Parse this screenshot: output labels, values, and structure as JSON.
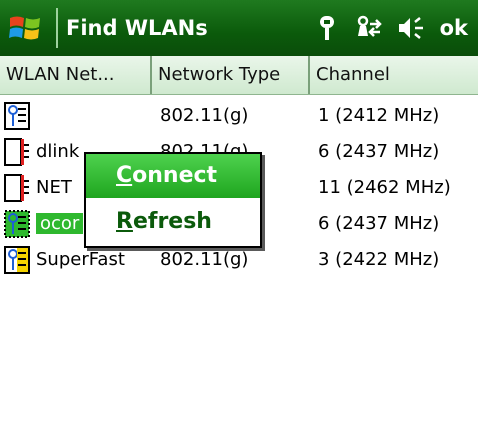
{
  "titlebar": {
    "title": "Find WLANs",
    "ok_label": "ok",
    "icons": [
      "windows-start-icon",
      "antenna-icon",
      "connectivity-icon",
      "speaker-icon"
    ]
  },
  "table": {
    "columns": [
      "WLAN Net...",
      "Network Type",
      "Channel"
    ],
    "rows": [
      {
        "name": "",
        "type": "802.11(g)",
        "channel": "1 (2412 MHz)",
        "icon": "access-point-icon",
        "selected": false
      },
      {
        "name": "dlink",
        "type": "802.11(g)",
        "channel": "6 (2437 MHz)",
        "icon": "ad-hoc-icon",
        "selected": false
      },
      {
        "name": "NET",
        "type": "",
        "channel": "11 (2462 MHz)",
        "icon": "ad-hoc-icon",
        "selected": false
      },
      {
        "name": "ocor",
        "type": "",
        "channel": "6 (2437 MHz)",
        "icon": "access-point-icon",
        "selected": true
      },
      {
        "name": "SuperFast",
        "type": "802.11(g)",
        "channel": "3 (2422 MHz)",
        "icon": "access-point-secure-icon",
        "selected": false
      }
    ]
  },
  "context_menu": {
    "items": [
      {
        "label_first": "C",
        "label_rest": "onnect",
        "active": true
      },
      {
        "label_first": "R",
        "label_rest": "efresh",
        "active": false
      }
    ]
  },
  "colors": {
    "titlebar": "#0b5a0b",
    "selection": "#2eb82e",
    "menu_highlight": "#1fa51f"
  }
}
